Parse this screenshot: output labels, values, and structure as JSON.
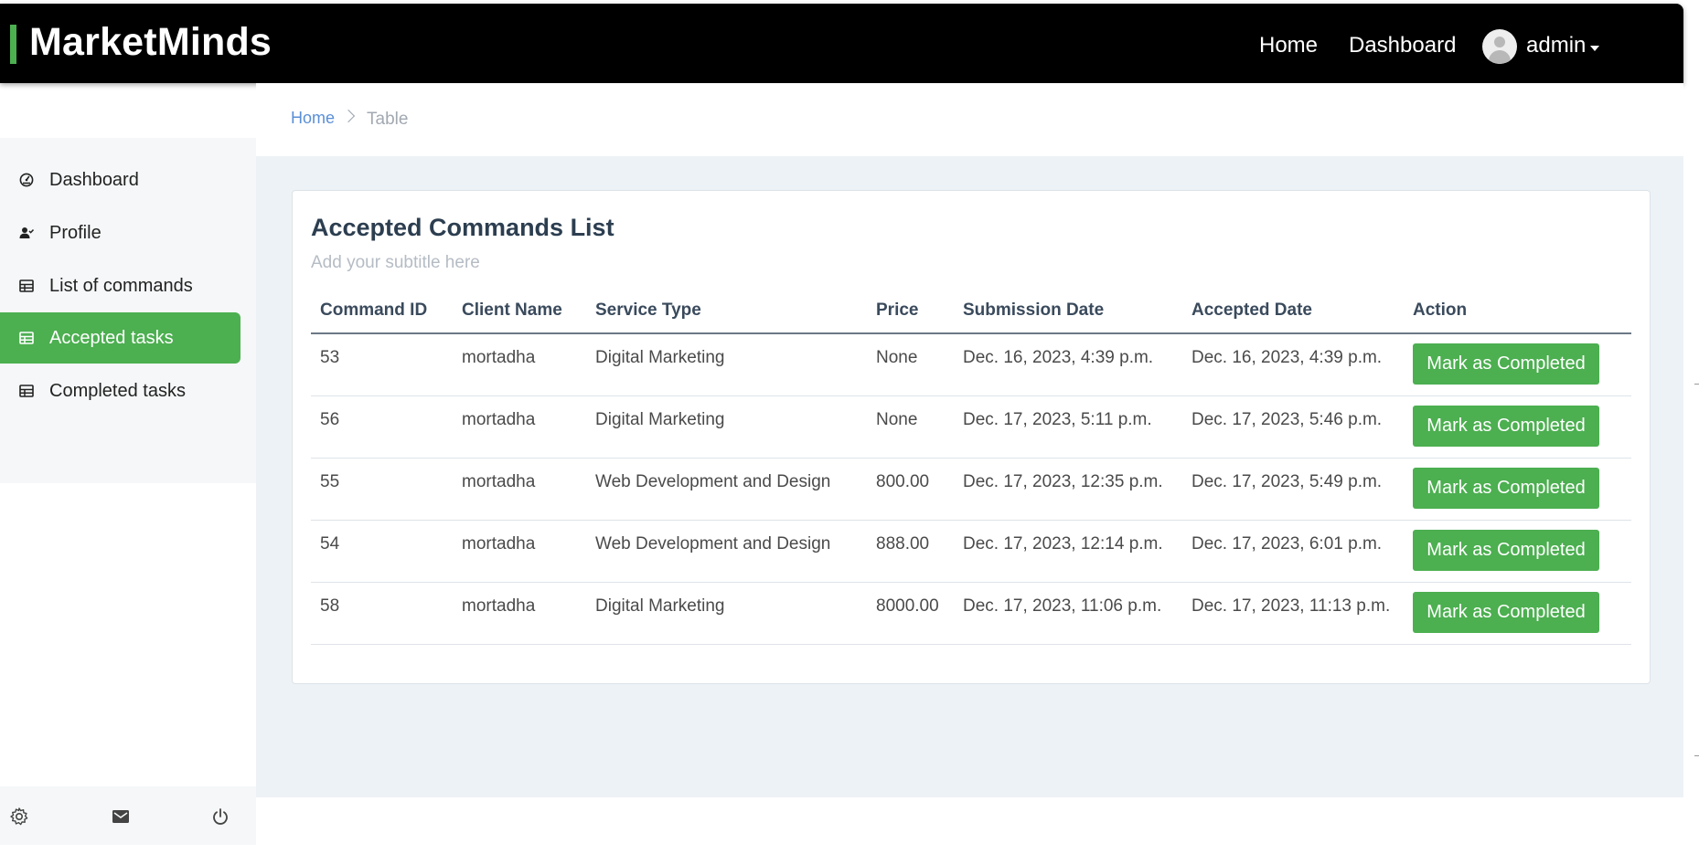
{
  "app": {
    "brand": "MarketMinds"
  },
  "header": {
    "nav": {
      "home": "Home",
      "dashboard": "Dashboard"
    },
    "user": {
      "name": "admin"
    }
  },
  "sidebar": {
    "items": [
      {
        "label": "Dashboard",
        "icon": "dashboard-icon",
        "active": false
      },
      {
        "label": "Profile",
        "icon": "user-check-icon",
        "active": false
      },
      {
        "label": "List of commands",
        "icon": "table-icon",
        "active": false
      },
      {
        "label": "Accepted tasks",
        "icon": "table-icon",
        "active": true
      },
      {
        "label": "Completed tasks",
        "icon": "table-icon",
        "active": false
      }
    ],
    "footer_icons": [
      "gear-icon",
      "mail-icon",
      "power-icon"
    ]
  },
  "breadcrumb": {
    "home": "Home",
    "current": "Table"
  },
  "card": {
    "title": "Accepted Commands List",
    "subtitle": "Add your subtitle here"
  },
  "table": {
    "columns": [
      "Command ID",
      "Client Name",
      "Service Type",
      "Price",
      "Submission Date",
      "Accepted Date",
      "Action"
    ],
    "rows": [
      {
        "id": "53",
        "client": "mortadha",
        "service": "Digital Marketing",
        "price": "None",
        "submitted": "Dec. 16, 2023, 4:39 p.m.",
        "accepted": "Dec. 16, 2023, 4:39 p.m.",
        "action": "Mark as Completed"
      },
      {
        "id": "56",
        "client": "mortadha",
        "service": "Digital Marketing",
        "price": "None",
        "submitted": "Dec. 17, 2023, 5:11 p.m.",
        "accepted": "Dec. 17, 2023, 5:46 p.m.",
        "action": "Mark as Completed"
      },
      {
        "id": "55",
        "client": "mortadha",
        "service": "Web Development and Design",
        "price": "800.00",
        "submitted": "Dec. 17, 2023, 12:35 p.m.",
        "accepted": "Dec. 17, 2023, 5:49 p.m.",
        "action": "Mark as Completed"
      },
      {
        "id": "54",
        "client": "mortadha",
        "service": "Web Development and Design",
        "price": "888.00",
        "submitted": "Dec. 17, 2023, 12:14 p.m.",
        "accepted": "Dec. 17, 2023, 6:01 p.m.",
        "action": "Mark as Completed"
      },
      {
        "id": "58",
        "client": "mortadha",
        "service": "Digital Marketing",
        "price": "8000.00",
        "submitted": "Dec. 17, 2023, 11:06 p.m.",
        "accepted": "Dec. 17, 2023, 11:13 p.m.",
        "action": "Mark as Completed"
      }
    ]
  },
  "colors": {
    "accent": "#4caf50",
    "topbar": "#000000",
    "content_bg": "#edf2f6",
    "link": "#5b8fd6"
  }
}
